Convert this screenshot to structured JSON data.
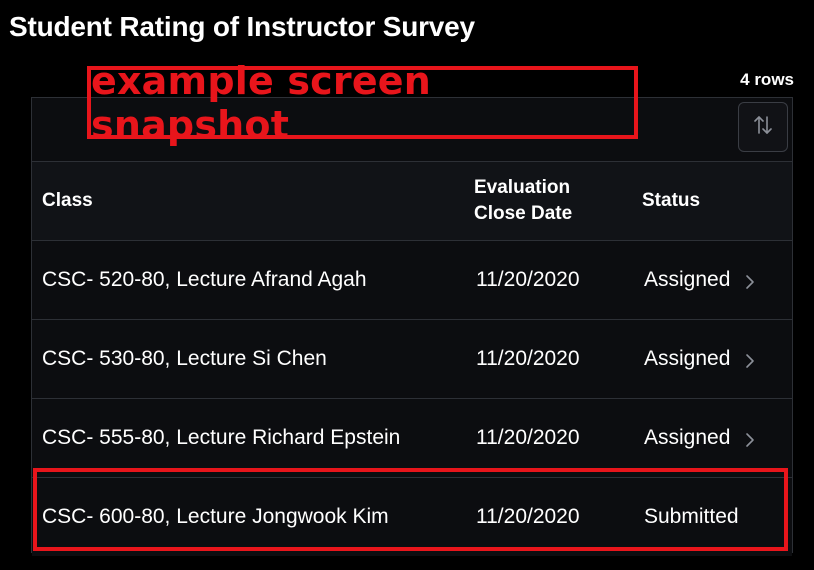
{
  "page": {
    "title": "Student Rating of Instructor Survey",
    "row_count": "4 rows"
  },
  "annotation": {
    "banner_text": "example screen snapshot",
    "color": "#e8151b"
  },
  "toolbar": {
    "sort_icon": "sort-arrows-icon"
  },
  "table": {
    "headers": {
      "class": "Class",
      "close_date": "Evaluation\nClose Date",
      "status": "Status"
    },
    "rows": [
      {
        "class": "CSC- 520-80, Lecture Afrand Agah",
        "close_date": "11/20/2020",
        "status": "Assigned",
        "has_chevron": true
      },
      {
        "class": "CSC- 530-80, Lecture Si Chen",
        "close_date": "11/20/2020",
        "status": "Assigned",
        "has_chevron": true
      },
      {
        "class": "CSC- 555-80, Lecture Richard Epstein",
        "close_date": "11/20/2020",
        "status": "Assigned",
        "has_chevron": true
      },
      {
        "class": "CSC- 600-80, Lecture Jongwook Kim",
        "close_date": "11/20/2020",
        "status": "Submitted",
        "has_chevron": false
      }
    ]
  },
  "colors": {
    "background": "#000000",
    "panel": "#0c0d10",
    "border": "#2d3036",
    "text": "#ffffff"
  }
}
